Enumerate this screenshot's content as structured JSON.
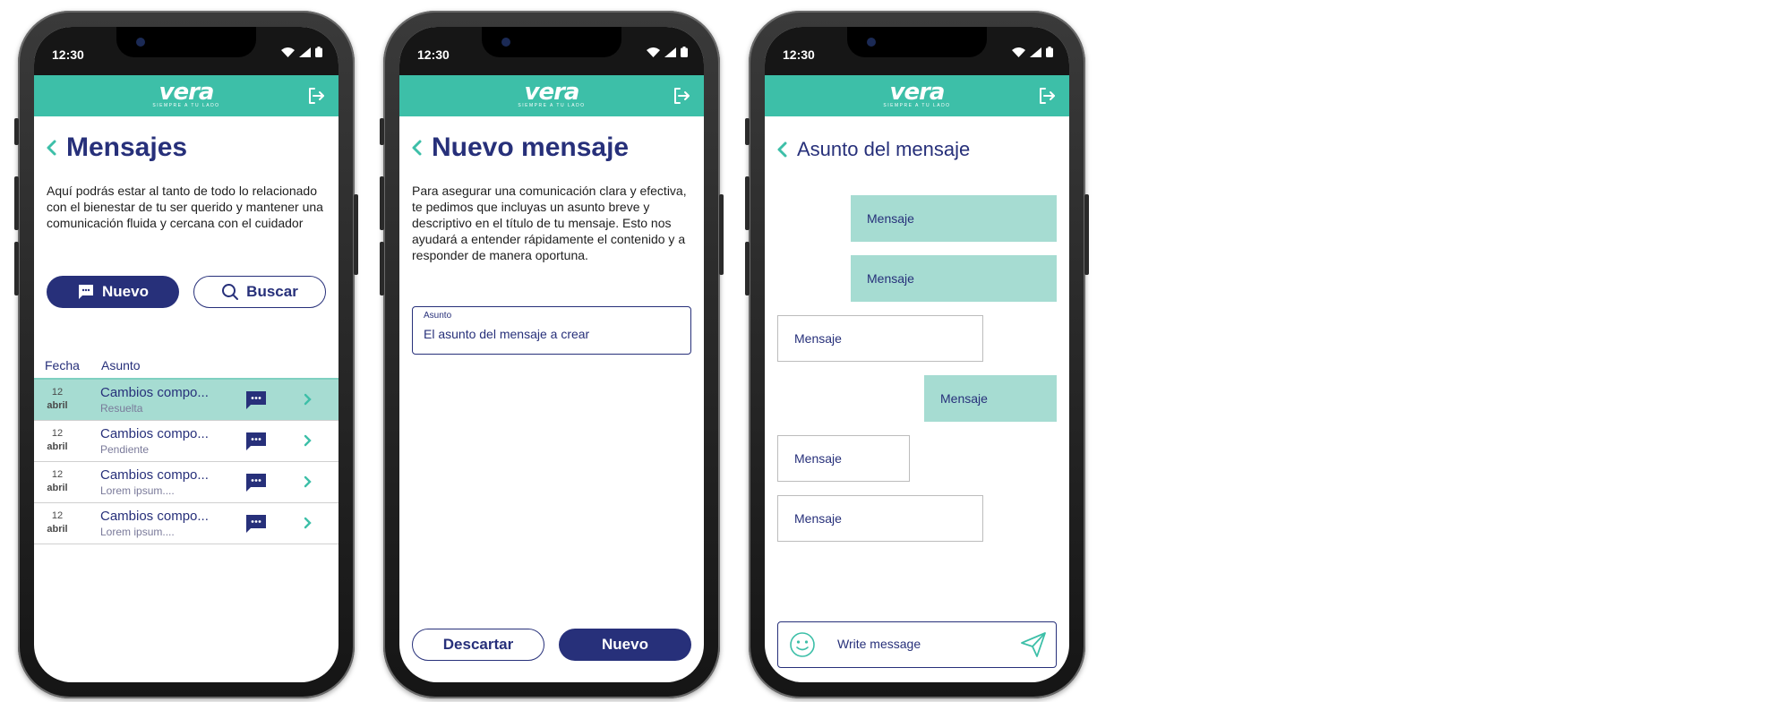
{
  "status": {
    "time": "12:30"
  },
  "brand": {
    "name": "vera",
    "tagline": "SIEMPRE A TU LADO"
  },
  "colors": {
    "accent": "#3dbfa8",
    "primary": "#27307a",
    "bubble_out": "#a6dcd2"
  },
  "messages_screen": {
    "title": "Mensajes",
    "description": "Aquí podrás estar al tanto de todo lo relacionado con el bienestar de tu ser querido y mantener una comunicación fluida y cercana con el cuidador",
    "new_label": "Nuevo",
    "search_label": "Buscar",
    "col_date": "Fecha",
    "col_subject": "Asunto",
    "rows": [
      {
        "day": "12",
        "month": "abril",
        "subject": "Cambios compo...",
        "status": "Resuelta"
      },
      {
        "day": "12",
        "month": "abril",
        "subject": "Cambios compo...",
        "status": "Pendiente"
      },
      {
        "day": "12",
        "month": "abril",
        "subject": "Cambios compo...",
        "status": "Lorem ipsum...."
      },
      {
        "day": "12",
        "month": "abril",
        "subject": "Cambios compo...",
        "status": "Lorem ipsum...."
      }
    ]
  },
  "new_message_screen": {
    "title": "Nuevo mensaje",
    "description": "Para asegurar una comunicación clara y efectiva, te pedimos que incluyas un asunto breve y descriptivo en el título de tu mensaje. Esto nos ayudará a entender rápidamente el contenido y a responder de manera oportuna.",
    "field_label": "Asunto",
    "field_value": "El asunto del mensaje a crear",
    "discard_label": "Descartar",
    "new_label": "Nuevo"
  },
  "chat_screen": {
    "title": "Asunto del mensaje",
    "bubbles": [
      {
        "text": "Mensaje",
        "side": "out"
      },
      {
        "text": "Mensaje",
        "side": "out"
      },
      {
        "text": "Mensaje",
        "side": "in"
      },
      {
        "text": "Mensaje",
        "side": "out"
      },
      {
        "text": "Mensaje",
        "side": "in"
      },
      {
        "text": "Mensaje",
        "side": "in"
      }
    ],
    "input_placeholder": "Write message"
  },
  "icons": [
    "exit-icon",
    "back-chevron-icon",
    "chat-icon",
    "search-icon",
    "chevron-right-icon",
    "emoji-icon",
    "send-icon",
    "wifi-icon",
    "signal-icon",
    "battery-icon"
  ]
}
